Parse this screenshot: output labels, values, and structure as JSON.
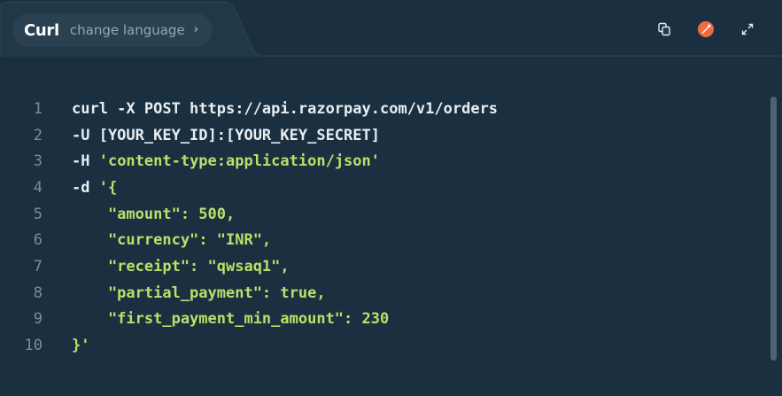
{
  "header": {
    "language": "Curl",
    "change_label": "change language",
    "chevron": "›",
    "actions": [
      {
        "icon": "copy-icon"
      },
      {
        "icon": "postman-icon"
      },
      {
        "icon": "expand-icon"
      }
    ]
  },
  "code": {
    "lines": [
      {
        "n": "1",
        "parts": [
          {
            "t": "curl -X POST https://api.razorpay.com/v1/orders",
            "c": "plain"
          }
        ]
      },
      {
        "n": "2",
        "parts": [
          {
            "t": "-U [YOUR_KEY_ID]:[YOUR_KEY_SECRET]",
            "c": "plain"
          }
        ]
      },
      {
        "n": "3",
        "parts": [
          {
            "t": "-H ",
            "c": "plain"
          },
          {
            "t": "'content-type:application/json'",
            "c": "str"
          }
        ]
      },
      {
        "n": "4",
        "parts": [
          {
            "t": "-d ",
            "c": "plain"
          },
          {
            "t": "'{",
            "c": "str"
          }
        ]
      },
      {
        "n": "5",
        "parts": [
          {
            "t": "    \"amount\": 500,",
            "c": "str"
          }
        ]
      },
      {
        "n": "6",
        "parts": [
          {
            "t": "    \"currency\": \"INR\",",
            "c": "str"
          }
        ]
      },
      {
        "n": "7",
        "parts": [
          {
            "t": "    \"receipt\": \"qwsaq1\",",
            "c": "str"
          }
        ]
      },
      {
        "n": "8",
        "parts": [
          {
            "t": "    \"partial_payment\": true,",
            "c": "str"
          }
        ]
      },
      {
        "n": "9",
        "parts": [
          {
            "t": "    \"first_payment_min_amount\": 230",
            "c": "str"
          }
        ]
      },
      {
        "n": "10",
        "parts": [
          {
            "t": "}'",
            "c": "str"
          }
        ]
      }
    ]
  },
  "colors": {
    "background": "#1a3040",
    "header": "#1f3546",
    "string": "#b8e06a",
    "plain": "#e8eef2",
    "line_number": "#7a8c99",
    "accent": "#f26a3d"
  }
}
